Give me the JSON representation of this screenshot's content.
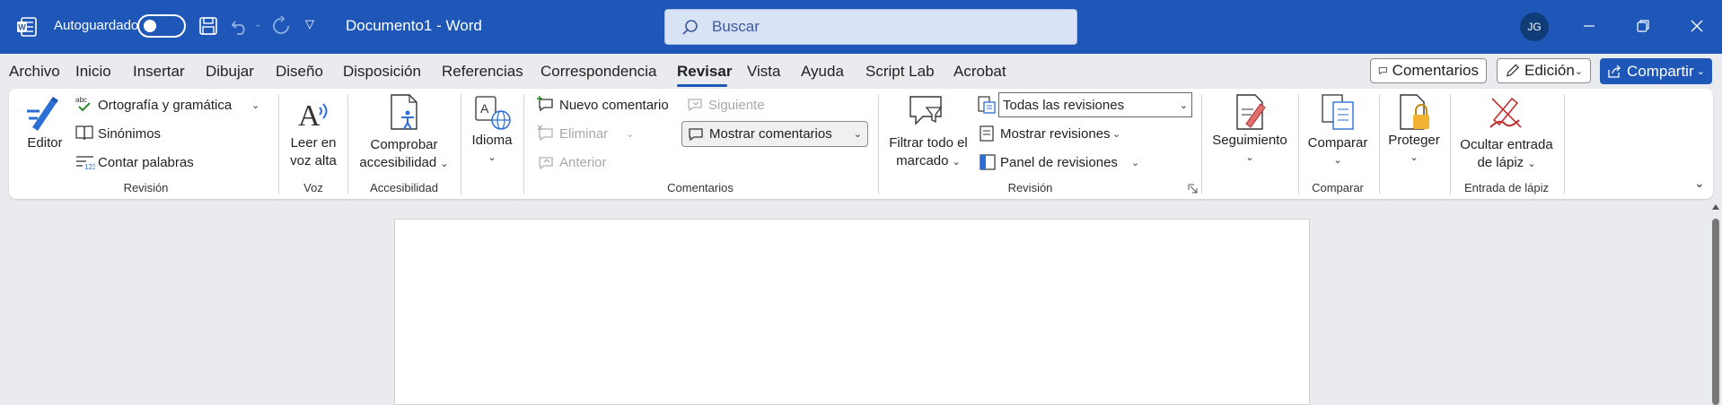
{
  "titlebar": {
    "autosave_label": "Autoguardado",
    "doc_title": "Documento1  -  Word",
    "search_placeholder": "Buscar",
    "user_initials": "JG"
  },
  "tabs": [
    "Archivo",
    "Inicio",
    "Insertar",
    "Dibujar",
    "Diseño",
    "Disposición",
    "Referencias",
    "Correspondencia",
    "Revisar",
    "Vista",
    "Ayuda",
    "Script Lab",
    "Acrobat"
  ],
  "active_tab": "Revisar",
  "menubar": {
    "comentarios": "Comentarios",
    "edicion": "Edición",
    "compartir": "Compartir"
  },
  "ribbon": {
    "revision1": {
      "editor": "Editor",
      "ortografia": "Ortografía y gramática",
      "sinonimos": "Sinónimos",
      "contar": "Contar palabras",
      "label": "Revisión"
    },
    "voz": {
      "leer_1": "Leer en",
      "leer_2": "voz alta",
      "label": "Voz"
    },
    "accesibilidad": {
      "comprobar_1": "Comprobar",
      "comprobar_2": "accesibilidad",
      "label": "Accesibilidad"
    },
    "idioma": {
      "idioma": "Idioma"
    },
    "comentarios": {
      "nuevo": "Nuevo comentario",
      "eliminar": "Eliminar",
      "anterior": "Anterior",
      "siguiente": "Siguiente",
      "mostrar": "Mostrar comentarios",
      "label": "Comentarios"
    },
    "revision2": {
      "filtrar_1": "Filtrar todo el",
      "filtrar_2": "marcado",
      "todas": "Todas las revisiones",
      "mostrar_rev": "Mostrar revisiones",
      "panel": "Panel de revisiones",
      "label": "Revisión"
    },
    "seguimiento": {
      "seguimiento": "Seguimiento"
    },
    "comparar": {
      "comparar": "Comparar",
      "label": "Comparar"
    },
    "proteger": {
      "proteger": "Proteger"
    },
    "lapiz": {
      "ocultar_1": "Ocultar entrada",
      "ocultar_2": "de lápiz",
      "label": "Entrada de lápiz"
    }
  },
  "colors": {
    "titlebar": "#1e57b8",
    "background": "#e9ebef",
    "accent": "#1e57b8"
  }
}
